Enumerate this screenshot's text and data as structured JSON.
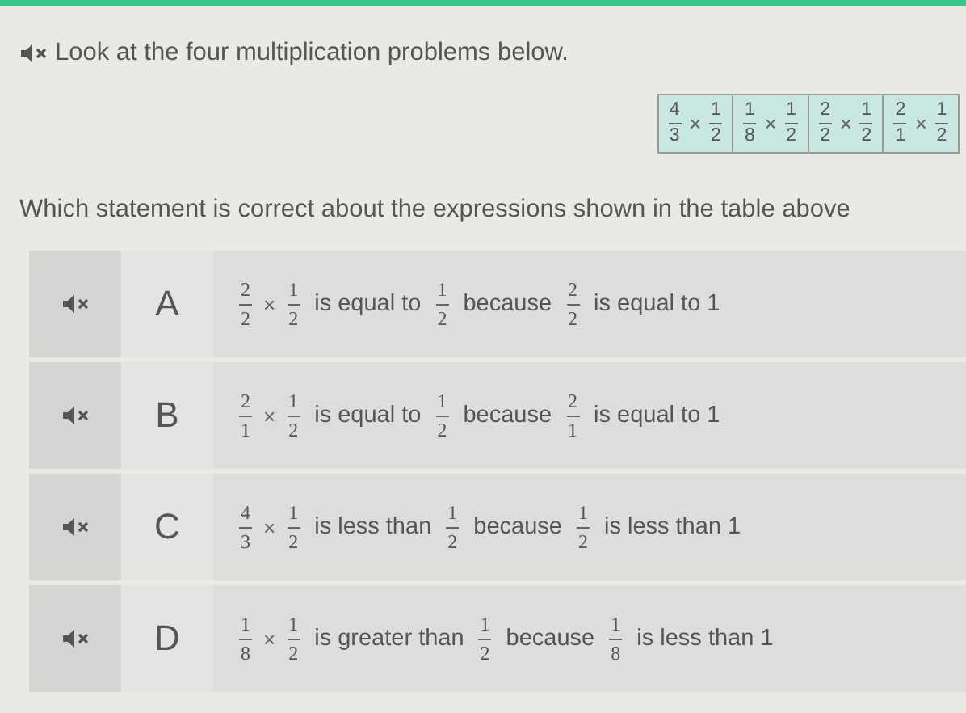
{
  "prompt": {
    "text": "Look at the four multiplication problems below."
  },
  "table": {
    "cells": [
      [
        {
          "kind": "fraction",
          "num": "4",
          "den": "3"
        },
        {
          "kind": "op",
          "text": "×"
        },
        {
          "kind": "fraction",
          "num": "1",
          "den": "2"
        }
      ],
      [
        {
          "kind": "fraction",
          "num": "1",
          "den": "8"
        },
        {
          "kind": "op",
          "text": "×"
        },
        {
          "kind": "fraction",
          "num": "1",
          "den": "2"
        }
      ],
      [
        {
          "kind": "fraction",
          "num": "2",
          "den": "2"
        },
        {
          "kind": "op",
          "text": "×"
        },
        {
          "kind": "fraction",
          "num": "1",
          "den": "2"
        }
      ],
      [
        {
          "kind": "fraction",
          "num": "2",
          "den": "1"
        },
        {
          "kind": "op",
          "text": "×"
        },
        {
          "kind": "fraction",
          "num": "1",
          "den": "2"
        }
      ]
    ]
  },
  "question": {
    "text": "Which statement is correct about the expressions shown in the table above"
  },
  "options": [
    {
      "letter": "A",
      "parts": [
        {
          "kind": "fraction",
          "num": "2",
          "den": "2"
        },
        {
          "kind": "op",
          "text": "×"
        },
        {
          "kind": "fraction",
          "num": "1",
          "den": "2"
        },
        {
          "kind": "text",
          "text": "is equal to"
        },
        {
          "kind": "fraction",
          "num": "1",
          "den": "2"
        },
        {
          "kind": "text",
          "text": "because"
        },
        {
          "kind": "fraction",
          "num": "2",
          "den": "2"
        },
        {
          "kind": "text",
          "text": "is equal to 1"
        }
      ]
    },
    {
      "letter": "B",
      "parts": [
        {
          "kind": "fraction",
          "num": "2",
          "den": "1"
        },
        {
          "kind": "op",
          "text": "×"
        },
        {
          "kind": "fraction",
          "num": "1",
          "den": "2"
        },
        {
          "kind": "text",
          "text": "is equal to"
        },
        {
          "kind": "fraction",
          "num": "1",
          "den": "2"
        },
        {
          "kind": "text",
          "text": "because"
        },
        {
          "kind": "fraction",
          "num": "2",
          "den": "1"
        },
        {
          "kind": "text",
          "text": "is equal to 1"
        }
      ]
    },
    {
      "letter": "C",
      "parts": [
        {
          "kind": "fraction",
          "num": "4",
          "den": "3"
        },
        {
          "kind": "op",
          "text": "×"
        },
        {
          "kind": "fraction",
          "num": "1",
          "den": "2"
        },
        {
          "kind": "text",
          "text": "is less than"
        },
        {
          "kind": "fraction",
          "num": "1",
          "den": "2"
        },
        {
          "kind": "text",
          "text": "because"
        },
        {
          "kind": "fraction",
          "num": "1",
          "den": "2"
        },
        {
          "kind": "text",
          "text": "is less than 1"
        }
      ]
    },
    {
      "letter": "D",
      "parts": [
        {
          "kind": "fraction",
          "num": "1",
          "den": "8"
        },
        {
          "kind": "op",
          "text": "×"
        },
        {
          "kind": "fraction",
          "num": "1",
          "den": "2"
        },
        {
          "kind": "text",
          "text": "is greater than"
        },
        {
          "kind": "fraction",
          "num": "1",
          "den": "2"
        },
        {
          "kind": "text",
          "text": "because"
        },
        {
          "kind": "fraction",
          "num": "1",
          "den": "8"
        },
        {
          "kind": "text",
          "text": "is less than 1"
        }
      ]
    }
  ]
}
